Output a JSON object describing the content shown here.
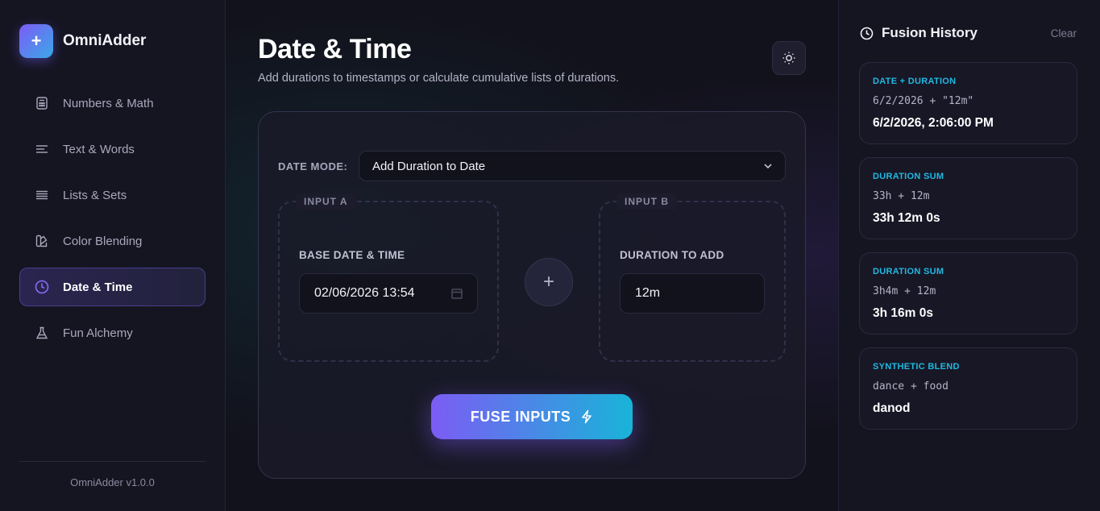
{
  "brand": {
    "name": "OmniAdder",
    "logo_glyph": "+"
  },
  "sidebar": {
    "items": [
      {
        "label": "Numbers & Math",
        "icon": "calculator-icon",
        "active": false
      },
      {
        "label": "Text & Words",
        "icon": "text-lines-icon",
        "active": false
      },
      {
        "label": "Lists & Sets",
        "icon": "list-icon",
        "active": false
      },
      {
        "label": "Color Blending",
        "icon": "palette-icon",
        "active": false
      },
      {
        "label": "Date & Time",
        "icon": "clock-icon",
        "active": true
      },
      {
        "label": "Fun Alchemy",
        "icon": "flask-icon",
        "active": false
      }
    ],
    "footer": "OmniAdder v1.0.0"
  },
  "header": {
    "title": "Date & Time",
    "subtitle": "Add durations to timestamps or calculate cumulative lists of durations.",
    "theme_icon": "sun-icon"
  },
  "mode": {
    "label": "DATE MODE:",
    "selected": "Add Duration to Date"
  },
  "input_a": {
    "tag": "INPUT A",
    "label": "BASE DATE & TIME",
    "value": "02/06/2026 13:54"
  },
  "input_b": {
    "tag": "INPUT B",
    "label": "DURATION TO ADD",
    "value": "12m"
  },
  "plus_glyph": "+",
  "fuse": {
    "label": "FUSE INPUTS"
  },
  "history": {
    "title": "Fusion History",
    "clear_label": "Clear",
    "items": [
      {
        "type": "DATE + DURATION",
        "expr": "6/2/2026 + \"12m\"",
        "result": "6/2/2026, 2:06:00 PM"
      },
      {
        "type": "DURATION SUM",
        "expr": "33h + 12m",
        "result": "33h 12m 0s"
      },
      {
        "type": "DURATION SUM",
        "expr": "3h4m + 12m",
        "result": "3h 16m 0s"
      },
      {
        "type": "SYNTHETIC BLEND",
        "expr": "dance + food",
        "result": "danod"
      }
    ]
  },
  "colors": {
    "accent_purple": "#7c5cf5",
    "accent_cyan": "#18b4d8",
    "history_type": "#22b8e0",
    "background": "#12121c"
  }
}
